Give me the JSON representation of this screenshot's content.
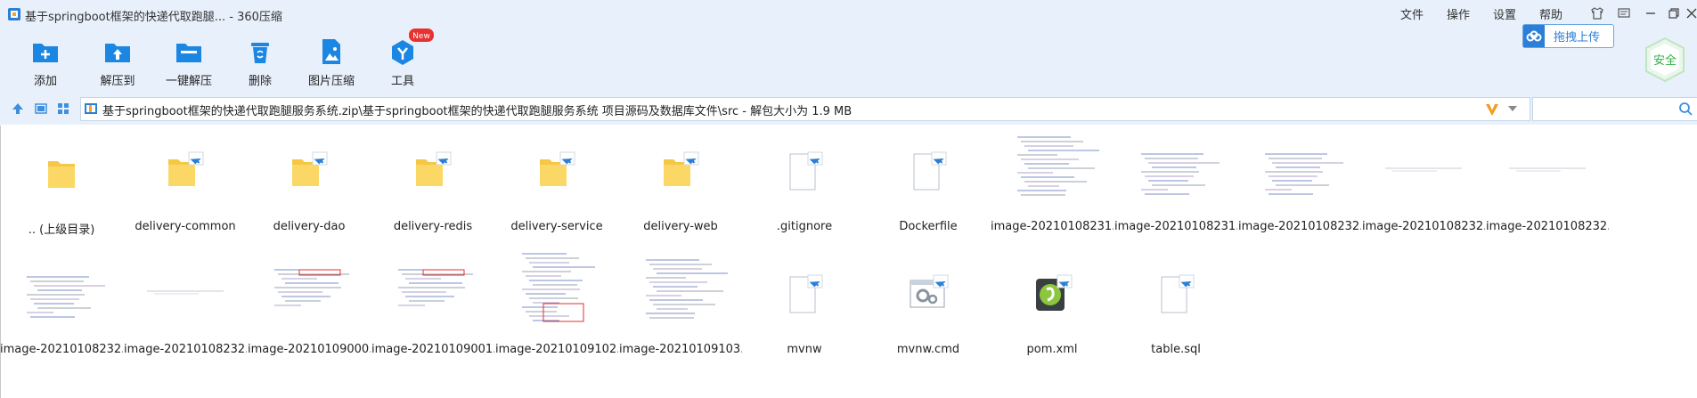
{
  "window": {
    "title": "基于springboot框架的快递代取跑腿... - 360压缩",
    "menu": [
      "文件",
      "操作",
      "设置",
      "帮助"
    ],
    "upload_label": "拖拽上传",
    "safe_label": "安全"
  },
  "toolbar": [
    {
      "label": "添加",
      "icon": "add-icon"
    },
    {
      "label": "解压到",
      "icon": "extract-to-icon"
    },
    {
      "label": "一键解压",
      "icon": "one-click-extract-icon"
    },
    {
      "label": "删除",
      "icon": "delete-icon"
    },
    {
      "label": "图片压缩",
      "icon": "image-compress-icon"
    },
    {
      "label": "工具",
      "icon": "tools-icon",
      "badge": "New"
    }
  ],
  "address": {
    "path": "基于springboot框架的快递代取跑腿服务系统.zip\\基于springboot框架的快递代取跑腿服务系统 项目源码及数据库文件\\src - 解包大小为 1.9 MB"
  },
  "files_row1": [
    {
      "name": ".. (上级目录)",
      "type": "folder-up"
    },
    {
      "name": "delivery-common",
      "type": "folder"
    },
    {
      "name": "delivery-dao",
      "type": "folder"
    },
    {
      "name": "delivery-redis",
      "type": "folder"
    },
    {
      "name": "delivery-service",
      "type": "folder"
    },
    {
      "name": "delivery-web",
      "type": "folder"
    },
    {
      "name": ".gitignore",
      "type": "file"
    },
    {
      "name": "Dockerfile",
      "type": "file"
    },
    {
      "name": "image-20210108231...",
      "type": "image-code"
    },
    {
      "name": "image-20210108231...",
      "type": "image-code-small"
    },
    {
      "name": "image-20210108232...",
      "type": "image-code-small"
    },
    {
      "name": "image-20210108232...",
      "type": "image-line"
    },
    {
      "name": "image-20210108232...",
      "type": "image-line"
    }
  ],
  "files_row2": [
    {
      "name": "image-20210108232...",
      "type": "image-code-small"
    },
    {
      "name": "image-20210108232...",
      "type": "image-line"
    },
    {
      "name": "image-20210109000...",
      "type": "image-code-red"
    },
    {
      "name": "image-20210109001...",
      "type": "image-code-red"
    },
    {
      "name": "image-20210109102...",
      "type": "image-code-tall"
    },
    {
      "name": "image-20210109103...",
      "type": "image-code"
    },
    {
      "name": "mvnw",
      "type": "file"
    },
    {
      "name": "mvnw.cmd",
      "type": "cmd"
    },
    {
      "name": "pom.xml",
      "type": "xml"
    },
    {
      "name": "table.sql",
      "type": "file"
    }
  ]
}
